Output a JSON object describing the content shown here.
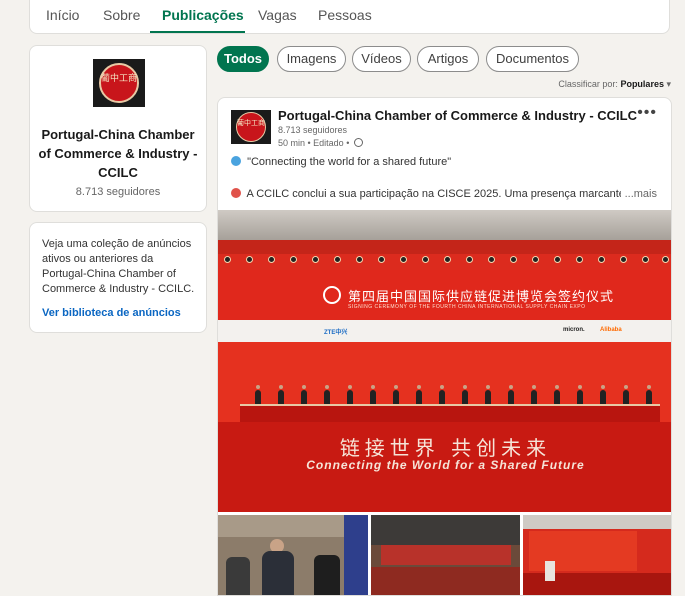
{
  "tabs": [
    "Início",
    "Sobre",
    "Publicações",
    "Vagas",
    "Pessoas"
  ],
  "company": {
    "logo_text": "葡中工商",
    "name": "Portugal-China Chamber of Commerce & Industry - CCILC",
    "followers": "8.713 seguidores"
  },
  "ads": {
    "text": "Veja uma coleção de anúncios ativos ou anteriores da Portugal-China Chamber of Commerce & Industry - CCILC.",
    "link": "Ver biblioteca de anúncios"
  },
  "filters": [
    "Todos",
    "Imagens",
    "Vídeos",
    "Artigos",
    "Documentos"
  ],
  "sort": {
    "label": "Classificar por:",
    "value": "Populares"
  },
  "post": {
    "author": "Portugal-China Chamber of Commerce & Industry - CCILC",
    "followers": "8.713 seguidores",
    "meta": "50 min • Editado •",
    "line1": "\"Connecting the world for a shared future\"",
    "line2": "A CCILC conclui a sua participação na CISCE 2025. Uma presença marcante,",
    "see_more": "...mais",
    "more_icon": "•••"
  },
  "image": {
    "cn_title": "第四届中国国际供应链促进博览会签约仪式",
    "en_subtitle": "SIGNING CEREMONY OF THE FOURTH CHINA INTERNATIONAL SUPPLY CHAIN EXPO",
    "floor_cn": "链接世界 共创未来",
    "floor_en": "Connecting the World for a Shared Future",
    "sponsors": [
      "ZTE中兴",
      "micron.",
      "Alibaba"
    ]
  },
  "colors": {
    "accent": "#01754f",
    "link": "#0a66c2",
    "stage_red": "#dc2b1e"
  }
}
